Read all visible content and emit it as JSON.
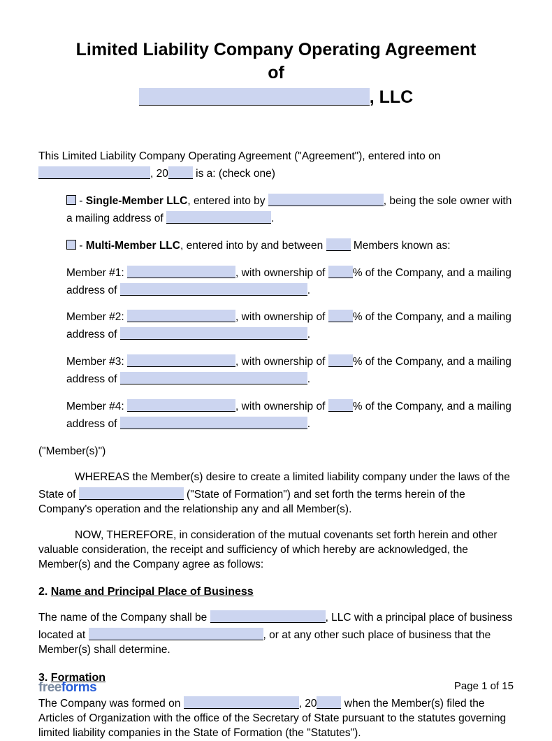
{
  "title": {
    "line1": "Limited Liability Company Operating Agreement",
    "line2_prefix": "of",
    "line2_suffix": ", LLC"
  },
  "intro": {
    "text1": "This Limited Liability Company Operating Agreement (\"Agreement\"), entered into on",
    "text2": ", 20",
    "text3": " is a: (check one)"
  },
  "single": {
    "dash": " - ",
    "bold": "Single-Member LLC",
    "t1": ", entered into by ",
    "t2": ", being the sole owner with a mailing address of ",
    "t3": "."
  },
  "multi": {
    "dash": " - ",
    "bold": "Multi-Member LLC",
    "t1": ", entered into by and between ",
    "t2": " Members known as:"
  },
  "members": [
    {
      "label": "Member #1: ",
      "t1": ", with ownership of ",
      "t2": "% of the Company, and a mailing address of ",
      "t3": "."
    },
    {
      "label": "Member #2: ",
      "t1": ", with ownership of ",
      "t2": "% of the Company, and a mailing address of ",
      "t3": "."
    },
    {
      "label": "Member #3: ",
      "t1": ", with ownership of ",
      "t2": "% of the Company, and a mailing address of ",
      "t3": "."
    },
    {
      "label": "Member #4: ",
      "t1": ", with ownership of ",
      "t2": "% of the Company, and a mailing address of ",
      "t3": "."
    }
  ],
  "members_close": "(\"Member(s)\")",
  "whereas": {
    "t1": "WHEREAS the Member(s) desire to create a limited liability company under the laws of the State of ",
    "t2": " (\"State of Formation\") and set forth the terms herein of the Company's operation and the relationship any and all Member(s)."
  },
  "now": "NOW, THEREFORE, in consideration of the mutual covenants set forth herein and other valuable consideration, the receipt and sufficiency of which hereby are acknowledged, the Member(s) and the Company agree as follows:",
  "section2": {
    "num": "2.  ",
    "title": "Name and Principal Place of Business",
    "t1": "The name of the Company shall be ",
    "t2": ", LLC with a principal place of business located at ",
    "t3": ", or at any other such place of business that the Member(s) shall determine."
  },
  "section3": {
    "num": "3.  ",
    "title": "Formation",
    "t1": "The Company was formed on ",
    "t2": ", 20",
    "t3": " when the Member(s) filed the Articles of Organization with the office of the Secretary of State pursuant to the statutes governing limited liability companies in the State of Formation (the \"Statutes\")."
  },
  "footer": {
    "logo_free": "free",
    "logo_forms": "forms",
    "page": "Page 1 of 15"
  }
}
